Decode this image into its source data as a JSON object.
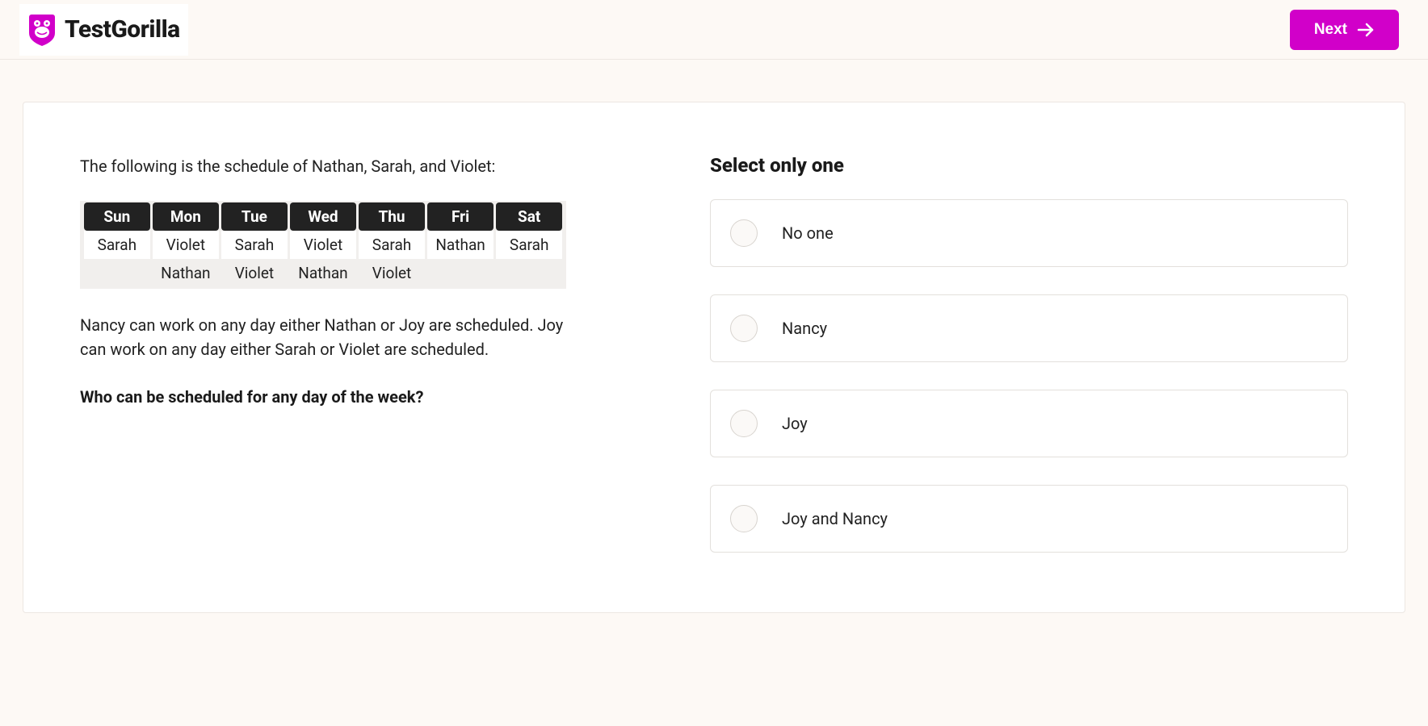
{
  "header": {
    "logo_text": "TestGorilla",
    "next_label": "Next"
  },
  "question": {
    "intro": "The following is the schedule of Nathan, Sarah, and Violet:",
    "schedule": {
      "days": [
        "Sun",
        "Mon",
        "Tue",
        "Wed",
        "Thu",
        "Fri",
        "Sat"
      ],
      "row1": [
        "Sarah",
        "Violet",
        "Sarah",
        "Violet",
        "Sarah",
        "Nathan",
        "Sarah"
      ],
      "row2": [
        "",
        "Nathan",
        "Violet",
        "Nathan",
        "Violet",
        "",
        ""
      ]
    },
    "rules": "Nancy can work on any day either Nathan or Joy are scheduled. Joy can work on any day either Sarah or Violet are scheduled.",
    "prompt": "Who can be scheduled for any day of the week?"
  },
  "answers": {
    "title": "Select only one",
    "options": [
      {
        "label": "No one"
      },
      {
        "label": "Nancy"
      },
      {
        "label": "Joy"
      },
      {
        "label": "Joy and Nancy"
      }
    ]
  }
}
